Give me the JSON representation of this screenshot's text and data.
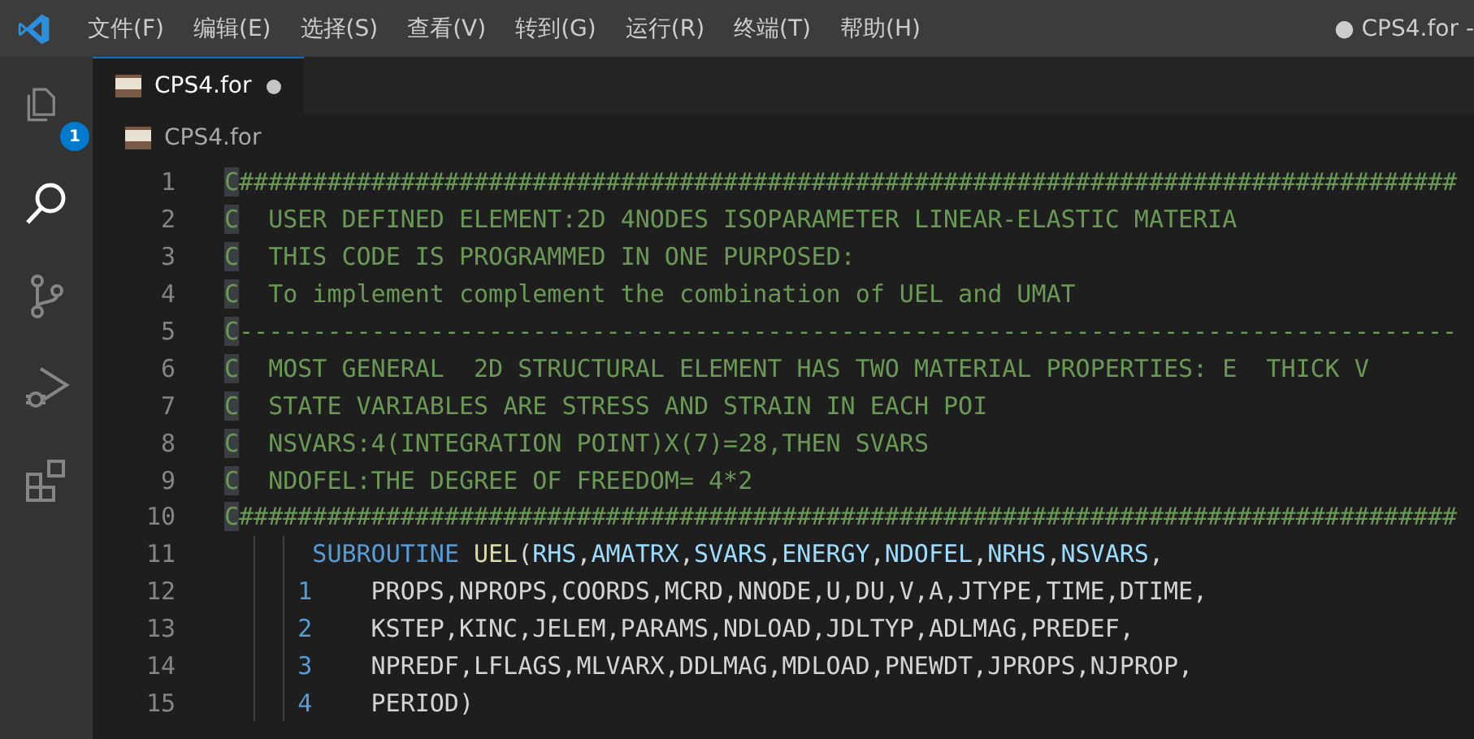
{
  "title_bar": {
    "menu": [
      "文件(F)",
      "编辑(E)",
      "选择(S)",
      "查看(V)",
      "转到(G)",
      "运行(R)",
      "终端(T)",
      "帮助(H)"
    ],
    "title": "● CPS4.for -"
  },
  "activity_bar": [
    {
      "kind": "explorer",
      "selected": false,
      "badge": "1"
    },
    {
      "kind": "search",
      "selected": true
    },
    {
      "kind": "source-control",
      "selected": false
    },
    {
      "kind": "run",
      "selected": false
    },
    {
      "kind": "extensions",
      "selected": false
    }
  ],
  "tabs": [
    {
      "label": "CPS4.for",
      "selected": true,
      "modified": true
    }
  ],
  "breadcrumb": "CPS4.for",
  "lines": [
    {
      "num": "1",
      "segments": [
        {
          "kind": "mark",
          "text": "C"
        },
        {
          "kind": "comment",
          "text": "###################################################################################"
        }
      ]
    },
    {
      "num": "2",
      "segments": [
        {
          "kind": "mark",
          "text": "C"
        },
        {
          "kind": "comment",
          "text": "  USER DEFINED ELEMENT:2D 4NODES ISOPARAMETER LINEAR-ELASTIC MATERIA"
        }
      ]
    },
    {
      "num": "3",
      "segments": [
        {
          "kind": "mark",
          "text": "C"
        },
        {
          "kind": "comment",
          "text": "  THIS CODE IS PROGRAMMED IN ONE PURPOSED:"
        }
      ]
    },
    {
      "num": "4",
      "segments": [
        {
          "kind": "mark",
          "text": "C"
        },
        {
          "kind": "comment",
          "text": "  To implement complement the combination of UEL and UMAT"
        }
      ]
    },
    {
      "num": "5",
      "segments": [
        {
          "kind": "mark",
          "text": "C"
        },
        {
          "kind": "comment",
          "text": "-----------------------------------------------------------------------------------"
        }
      ]
    },
    {
      "num": "6",
      "segments": [
        {
          "kind": "mark",
          "text": "C"
        },
        {
          "kind": "comment",
          "text": "  MOST GENERAL  2D STRUCTURAL ELEMENT HAS TWO MATERIAL PROPERTIES: E  THICK V"
        }
      ]
    },
    {
      "num": "7",
      "segments": [
        {
          "kind": "mark",
          "text": "C"
        },
        {
          "kind": "comment",
          "text": "  STATE VARIABLES ARE STRESS AND STRAIN IN EACH POI"
        }
      ]
    },
    {
      "num": "8",
      "segments": [
        {
          "kind": "mark",
          "text": "C"
        },
        {
          "kind": "comment",
          "text": "  NSVARS:4(INTEGRATION POINT)X(7)=28,THEN SVARS"
        }
      ]
    },
    {
      "num": "9",
      "segments": [
        {
          "kind": "mark",
          "text": "C"
        },
        {
          "kind": "comment",
          "text": "  NDOFEL:THE DEGREE OF FREEDOM= 4*2"
        }
      ]
    },
    {
      "num": "10",
      "segments": [
        {
          "kind": "mark",
          "text": "C"
        },
        {
          "kind": "comment",
          "text": "###################################################################################"
        }
      ]
    },
    {
      "num": "11",
      "kind": "statement",
      "segments": [
        {
          "kind": "keyword",
          "text": "SUBROUTINE"
        },
        {
          "kind": "function",
          "text": "UEL"
        },
        {
          "kind": "plain",
          "text": "("
        },
        {
          "kind": "variable",
          "text": "RHS"
        },
        {
          "kind": "plain",
          "text": ","
        },
        {
          "kind": "variable",
          "text": "AMATRX"
        },
        {
          "kind": "plain",
          "text": ","
        },
        {
          "kind": "variable",
          "text": "SVARS"
        },
        {
          "kind": "plain",
          "text": ","
        },
        {
          "kind": "variable",
          "text": "ENERGY"
        },
        {
          "kind": "plain",
          "text": ","
        },
        {
          "kind": "variable",
          "text": "NDOFEL"
        },
        {
          "kind": "plain",
          "text": ","
        },
        {
          "kind": "variable",
          "text": "NRHS"
        },
        {
          "kind": "plain",
          "text": ","
        },
        {
          "kind": "variable",
          "text": "NSVARS"
        },
        {
          "kind": "plain",
          "text": ","
        }
      ]
    },
    {
      "num": "12",
      "kind": "continuation",
      "segments": [
        {
          "kind": "number",
          "text": "1"
        },
        {
          "kind": "plain",
          "text": "PROPS,NPROPS,COORDS,MCRD,NNODE,U,DU,V,A,JTYPE,TIME,DTIME,"
        }
      ]
    },
    {
      "num": "13",
      "kind": "continuation",
      "segments": [
        {
          "kind": "number",
          "text": "2"
        },
        {
          "kind": "plain",
          "text": "KSTEP,KINC,JELEM,PARAMS,NDLOAD,JDLTYP,ADLMAG,PREDEF,"
        }
      ]
    },
    {
      "num": "14",
      "kind": "continuation",
      "segments": [
        {
          "kind": "number",
          "text": "3"
        },
        {
          "kind": "plain",
          "text": "NPREDF,LFLAGS,MLVARX,DDLMAG,MDLOAD,PNEWDT,JPROPS,NJPROP,"
        }
      ]
    },
    {
      "num": "15",
      "kind": "continuation",
      "segments": [
        {
          "kind": "number",
          "text": "4"
        },
        {
          "kind": "plain",
          "text": "PERIOD)"
        }
      ]
    }
  ]
}
